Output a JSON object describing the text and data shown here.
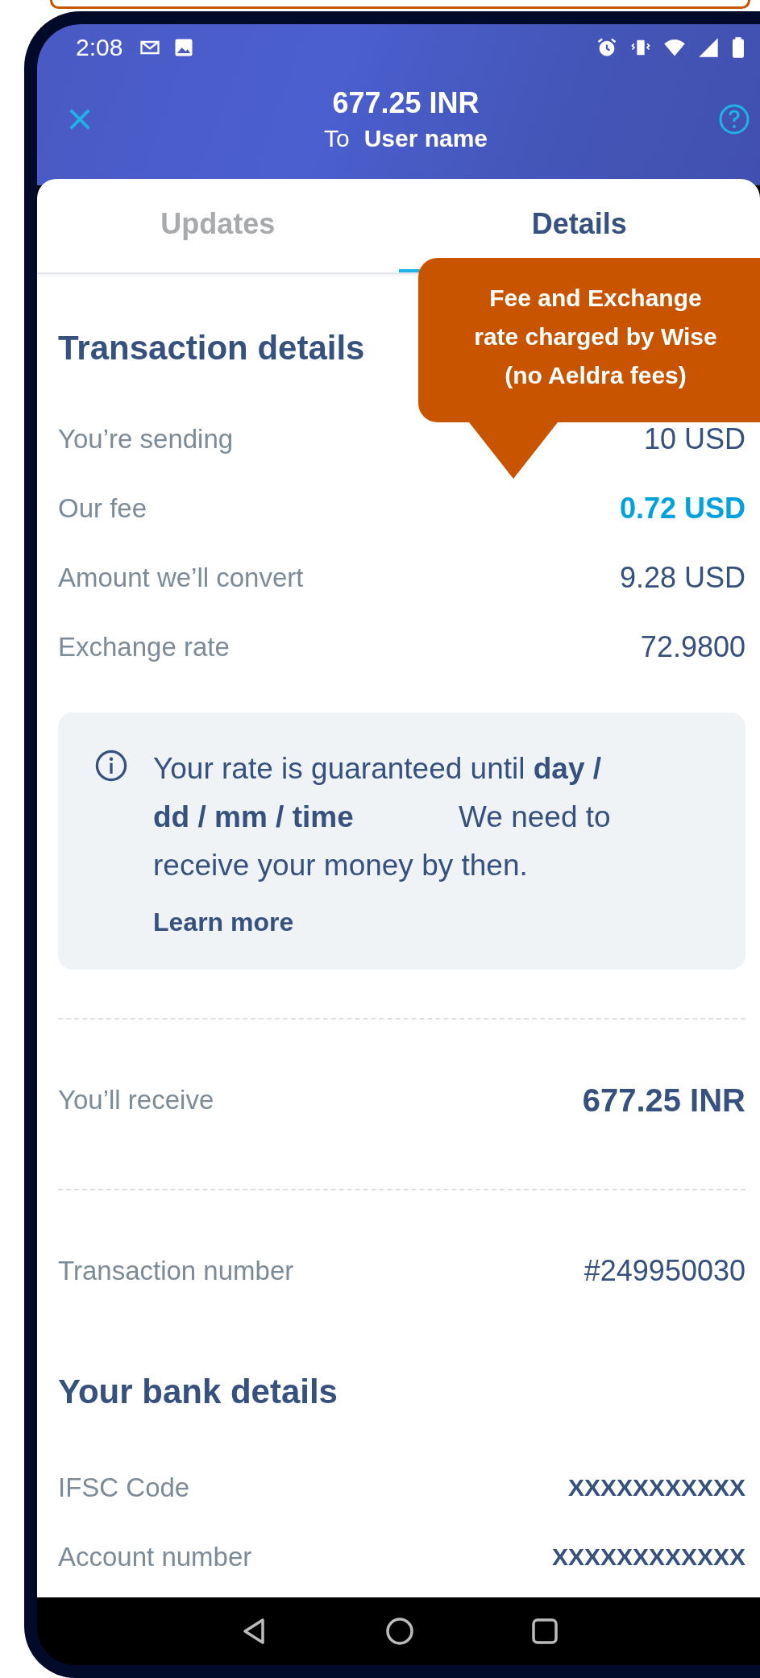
{
  "status_bar": {
    "time": "2:08"
  },
  "header": {
    "title": "677.25 INR",
    "to_label": "To",
    "recipient": "User name"
  },
  "tabs": [
    {
      "label": "Updates",
      "selected": false
    },
    {
      "label": "Details",
      "selected": true
    }
  ],
  "callout": {
    "lines": [
      "Fee and Exchange",
      "rate charged by Wise",
      "(no Aeldra fees)"
    ]
  },
  "transaction_details": {
    "title": "Transaction details",
    "rows": [
      {
        "label": "You’re sending",
        "value": "10 USD",
        "highlighted": false
      },
      {
        "label": "Our fee",
        "value": "0.72 USD",
        "highlighted": true
      },
      {
        "label": "Amount we’ll convert",
        "value": "9.28 USD",
        "highlighted": false
      },
      {
        "label": "Exchange rate",
        "value": "72.9800",
        "highlighted": false
      }
    ]
  },
  "notice": {
    "text": "Your rate is guaranteed until **day / dd / mm / time** We need to receive your money by then.",
    "link": "Learn more"
  },
  "receive": {
    "label": "You’ll receive",
    "value": "677.25 INR"
  },
  "transaction_number": {
    "label": "Transaction number",
    "value": "#249950030"
  },
  "bank_details": {
    "title": "Your bank details",
    "rows": [
      {
        "label": "IFSC Code",
        "value": "XXXXXXXXXXX"
      },
      {
        "label": "Account number",
        "value": "XXXXXXXXXXXX"
      }
    ]
  }
}
